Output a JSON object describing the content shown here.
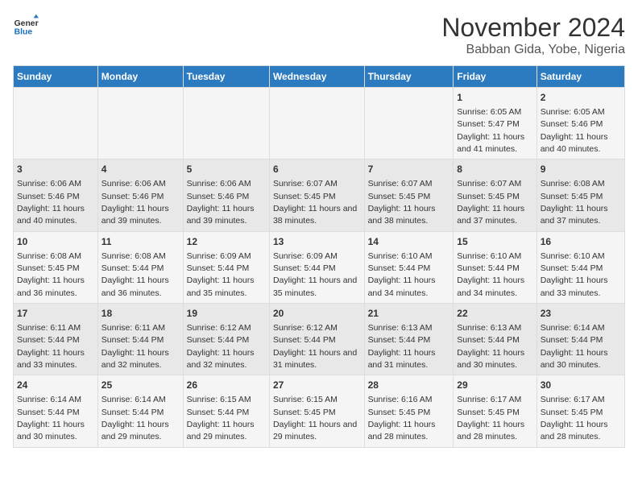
{
  "header": {
    "logo_general": "General",
    "logo_blue": "Blue",
    "title": "November 2024",
    "subtitle": "Babban Gida, Yobe, Nigeria"
  },
  "days_of_week": [
    "Sunday",
    "Monday",
    "Tuesday",
    "Wednesday",
    "Thursday",
    "Friday",
    "Saturday"
  ],
  "weeks": [
    [
      {
        "day": "",
        "info": ""
      },
      {
        "day": "",
        "info": ""
      },
      {
        "day": "",
        "info": ""
      },
      {
        "day": "",
        "info": ""
      },
      {
        "day": "",
        "info": ""
      },
      {
        "day": "1",
        "info": "Sunrise: 6:05 AM\nSunset: 5:47 PM\nDaylight: 11 hours and 41 minutes."
      },
      {
        "day": "2",
        "info": "Sunrise: 6:05 AM\nSunset: 5:46 PM\nDaylight: 11 hours and 40 minutes."
      }
    ],
    [
      {
        "day": "3",
        "info": "Sunrise: 6:06 AM\nSunset: 5:46 PM\nDaylight: 11 hours and 40 minutes."
      },
      {
        "day": "4",
        "info": "Sunrise: 6:06 AM\nSunset: 5:46 PM\nDaylight: 11 hours and 39 minutes."
      },
      {
        "day": "5",
        "info": "Sunrise: 6:06 AM\nSunset: 5:46 PM\nDaylight: 11 hours and 39 minutes."
      },
      {
        "day": "6",
        "info": "Sunrise: 6:07 AM\nSunset: 5:45 PM\nDaylight: 11 hours and 38 minutes."
      },
      {
        "day": "7",
        "info": "Sunrise: 6:07 AM\nSunset: 5:45 PM\nDaylight: 11 hours and 38 minutes."
      },
      {
        "day": "8",
        "info": "Sunrise: 6:07 AM\nSunset: 5:45 PM\nDaylight: 11 hours and 37 minutes."
      },
      {
        "day": "9",
        "info": "Sunrise: 6:08 AM\nSunset: 5:45 PM\nDaylight: 11 hours and 37 minutes."
      }
    ],
    [
      {
        "day": "10",
        "info": "Sunrise: 6:08 AM\nSunset: 5:45 PM\nDaylight: 11 hours and 36 minutes."
      },
      {
        "day": "11",
        "info": "Sunrise: 6:08 AM\nSunset: 5:44 PM\nDaylight: 11 hours and 36 minutes."
      },
      {
        "day": "12",
        "info": "Sunrise: 6:09 AM\nSunset: 5:44 PM\nDaylight: 11 hours and 35 minutes."
      },
      {
        "day": "13",
        "info": "Sunrise: 6:09 AM\nSunset: 5:44 PM\nDaylight: 11 hours and 35 minutes."
      },
      {
        "day": "14",
        "info": "Sunrise: 6:10 AM\nSunset: 5:44 PM\nDaylight: 11 hours and 34 minutes."
      },
      {
        "day": "15",
        "info": "Sunrise: 6:10 AM\nSunset: 5:44 PM\nDaylight: 11 hours and 34 minutes."
      },
      {
        "day": "16",
        "info": "Sunrise: 6:10 AM\nSunset: 5:44 PM\nDaylight: 11 hours and 33 minutes."
      }
    ],
    [
      {
        "day": "17",
        "info": "Sunrise: 6:11 AM\nSunset: 5:44 PM\nDaylight: 11 hours and 33 minutes."
      },
      {
        "day": "18",
        "info": "Sunrise: 6:11 AM\nSunset: 5:44 PM\nDaylight: 11 hours and 32 minutes."
      },
      {
        "day": "19",
        "info": "Sunrise: 6:12 AM\nSunset: 5:44 PM\nDaylight: 11 hours and 32 minutes."
      },
      {
        "day": "20",
        "info": "Sunrise: 6:12 AM\nSunset: 5:44 PM\nDaylight: 11 hours and 31 minutes."
      },
      {
        "day": "21",
        "info": "Sunrise: 6:13 AM\nSunset: 5:44 PM\nDaylight: 11 hours and 31 minutes."
      },
      {
        "day": "22",
        "info": "Sunrise: 6:13 AM\nSunset: 5:44 PM\nDaylight: 11 hours and 30 minutes."
      },
      {
        "day": "23",
        "info": "Sunrise: 6:14 AM\nSunset: 5:44 PM\nDaylight: 11 hours and 30 minutes."
      }
    ],
    [
      {
        "day": "24",
        "info": "Sunrise: 6:14 AM\nSunset: 5:44 PM\nDaylight: 11 hours and 30 minutes."
      },
      {
        "day": "25",
        "info": "Sunrise: 6:14 AM\nSunset: 5:44 PM\nDaylight: 11 hours and 29 minutes."
      },
      {
        "day": "26",
        "info": "Sunrise: 6:15 AM\nSunset: 5:44 PM\nDaylight: 11 hours and 29 minutes."
      },
      {
        "day": "27",
        "info": "Sunrise: 6:15 AM\nSunset: 5:45 PM\nDaylight: 11 hours and 29 minutes."
      },
      {
        "day": "28",
        "info": "Sunrise: 6:16 AM\nSunset: 5:45 PM\nDaylight: 11 hours and 28 minutes."
      },
      {
        "day": "29",
        "info": "Sunrise: 6:17 AM\nSunset: 5:45 PM\nDaylight: 11 hours and 28 minutes."
      },
      {
        "day": "30",
        "info": "Sunrise: 6:17 AM\nSunset: 5:45 PM\nDaylight: 11 hours and 28 minutes."
      }
    ]
  ]
}
